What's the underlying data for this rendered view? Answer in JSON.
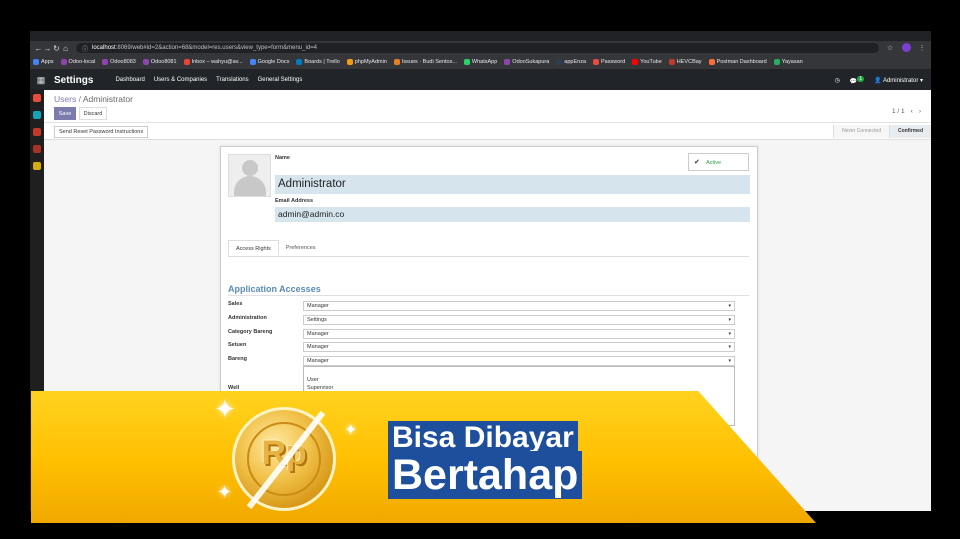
{
  "browser": {
    "url_host": "localhost",
    "url_rest": ":8069/web#id=2&action=68&model=res.users&view_type=form&menu_id=4",
    "profile_initial": "N",
    "bookmarks": [
      "Apps",
      "Odoo-local",
      "Odoo8083",
      "Odoo8081",
      "Inbox – wahyu@av...",
      "Google Docs",
      "Boards | Trello",
      "phpMyAdmin",
      "Issues · Budi Sentos...",
      "WhatsApp",
      "OdooSukapura",
      "appEnza",
      "Password",
      "YouTube",
      "HEVCBay",
      "Postman Dashboard",
      "Yayasan"
    ]
  },
  "odoo_nav": {
    "app_title": "Settings",
    "menu": [
      "Dashboard",
      "Users & Companies",
      "Translations",
      "General Settings"
    ],
    "chat_count": "1",
    "user": "Administrator"
  },
  "breadcrumb": {
    "parent": "Users",
    "current": "Administrator"
  },
  "buttons": {
    "save": "Save",
    "discard": "Discard",
    "reset_password": "Send Reset Password Instructions"
  },
  "pager": {
    "value": "1 / 1"
  },
  "stages": [
    "Never Connected",
    "Confirmed"
  ],
  "form": {
    "name_label": "Name",
    "name_value": "Administrator",
    "email_label": "Email Address",
    "email_value": "admin@admin.co",
    "active_label": "Active",
    "tabs": [
      "Access Rights",
      "Preferences"
    ],
    "section_title": "Application Accesses",
    "accesses": [
      {
        "label": "Sales",
        "value": "Manager"
      },
      {
        "label": "Administration",
        "value": "Settings"
      },
      {
        "label": "Category Bareng",
        "value": "Manager"
      },
      {
        "label": "Setuen",
        "value": "Manager"
      },
      {
        "label": "Bareng",
        "value": "Manager"
      }
    ],
    "dropdown_options": [
      "User",
      "Supervisor"
    ],
    "cut_label": "Well"
  },
  "banner": {
    "line1": "Bisa Dibayar",
    "line2": "Bertahap",
    "coin_text": "Rp"
  },
  "colors": {
    "odoo_purple": "#7c7bad",
    "banner_yellow": "#ffc400",
    "banner_text_bg": "#1e4f9c"
  }
}
